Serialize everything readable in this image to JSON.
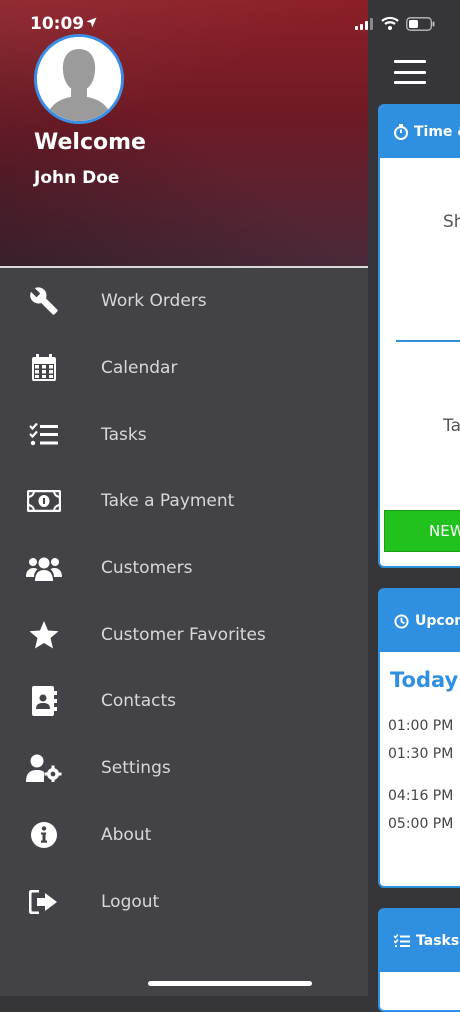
{
  "status_bar": {
    "time": "10:09"
  },
  "drawer": {
    "welcome": "Welcome",
    "user_name": "John Doe",
    "items": [
      {
        "label": "Work Orders",
        "icon": "wrench-icon"
      },
      {
        "label": "Calendar",
        "icon": "calendar-icon"
      },
      {
        "label": "Tasks",
        "icon": "task-list-icon"
      },
      {
        "label": "Take a Payment",
        "icon": "money-bill-icon"
      },
      {
        "label": "Customers",
        "icon": "users-icon"
      },
      {
        "label": "Customer Favorites",
        "icon": "star-icon"
      },
      {
        "label": "Contacts",
        "icon": "address-book-icon"
      },
      {
        "label": "Settings",
        "icon": "user-cog-icon"
      },
      {
        "label": "About",
        "icon": "info-circle-icon"
      },
      {
        "label": "Logout",
        "icon": "sign-out-icon"
      }
    ]
  },
  "main": {
    "time_card": {
      "title": "Time &",
      "text1": "Sh",
      "text2": "Ta",
      "new_button": "NEW"
    },
    "upcoming_card": {
      "title": "Upcom",
      "today": "Today's",
      "times": [
        "01:00 PM",
        "01:30 PM",
        "04:16 PM",
        "05:00 PM"
      ]
    },
    "tasks_card": {
      "title": "Tasks"
    }
  },
  "colors": {
    "accent": "#2f8fe0",
    "drawer_bg": "#434347",
    "new_button": "#22c21e",
    "hero_red": "#8c1f27"
  }
}
